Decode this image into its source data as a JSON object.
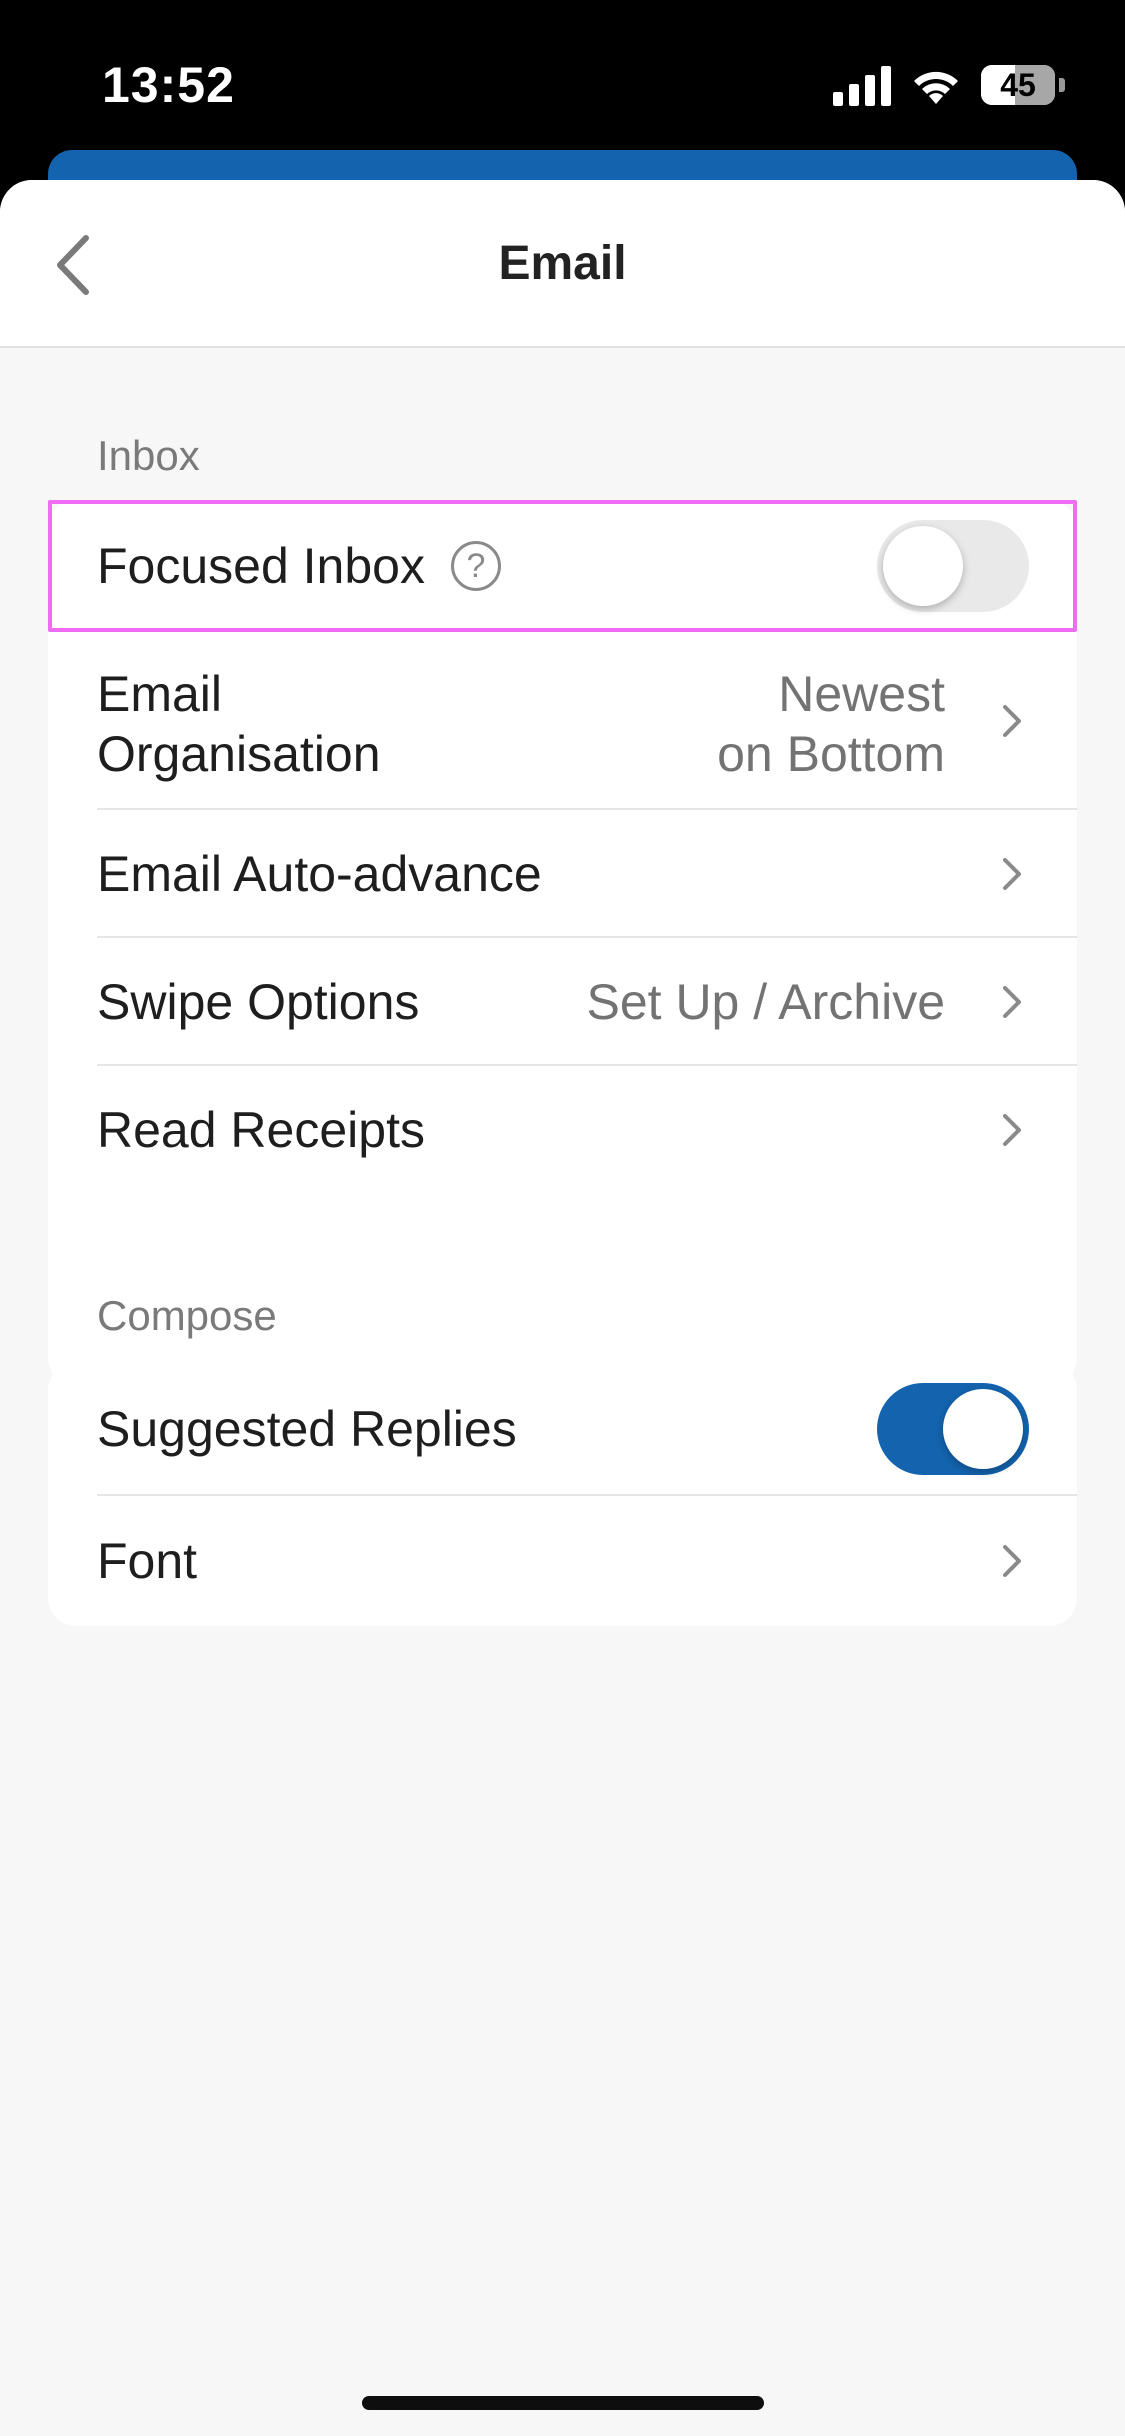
{
  "status_bar": {
    "time": "13:52",
    "battery": "45",
    "icons": [
      "signal-icon",
      "wifi-icon",
      "battery-icon"
    ]
  },
  "nav": {
    "title": "Email",
    "back_icon": "chevron-left-icon"
  },
  "sections": {
    "inbox": {
      "label": "Inbox",
      "rows": {
        "focused_inbox": {
          "label": "Focused Inbox",
          "help_glyph": "?",
          "toggle": false
        },
        "email_organisation": {
          "label_line1": "Email",
          "label_line2": "Organisation",
          "value_line1": "Newest",
          "value_line2": "on Bottom"
        },
        "auto_advance": {
          "label": "Email Auto-advance"
        },
        "swipe_options": {
          "label": "Swipe Options",
          "value": "Set Up / Archive"
        },
        "read_receipts": {
          "label": "Read Receipts"
        }
      }
    },
    "compose": {
      "label": "Compose",
      "rows": {
        "suggested_replies": {
          "label": "Suggested Replies",
          "toggle": true
        },
        "font": {
          "label": "Font"
        }
      }
    }
  },
  "colors": {
    "accent": "#1363ae",
    "highlight": "#f06cf4",
    "background": "#f7f7f7"
  }
}
